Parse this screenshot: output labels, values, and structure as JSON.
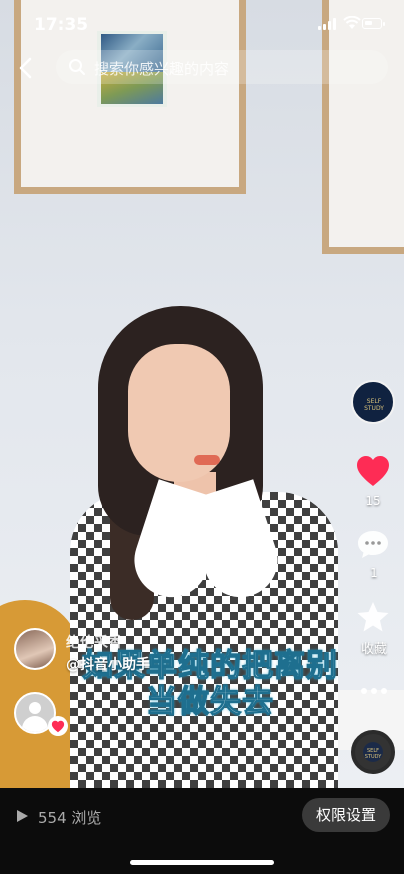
{
  "status_bar": {
    "time": "17:35"
  },
  "search": {
    "placeholder": "搜索你感兴趣的内容"
  },
  "creator": {
    "name": "绝伦采香"
  },
  "caption": {
    "line1": "如果单纯的把离别",
    "line2": "当做失去"
  },
  "mention": "@抖音小助手",
  "actions": {
    "like_count": "15",
    "comment_count": "1",
    "favorite_label": "收藏"
  },
  "bottom_bar": {
    "views": "554 浏览",
    "permission_button": "权限设置"
  },
  "icons": [
    "back-icon",
    "search-icon",
    "heart-icon",
    "comment-icon",
    "star-icon",
    "more-icon",
    "play-icon",
    "wifi-icon",
    "battery-icon",
    "signal-icon"
  ],
  "colors": {
    "like_red": "#fe2c55",
    "caption_outline": "#1e6f8f"
  }
}
